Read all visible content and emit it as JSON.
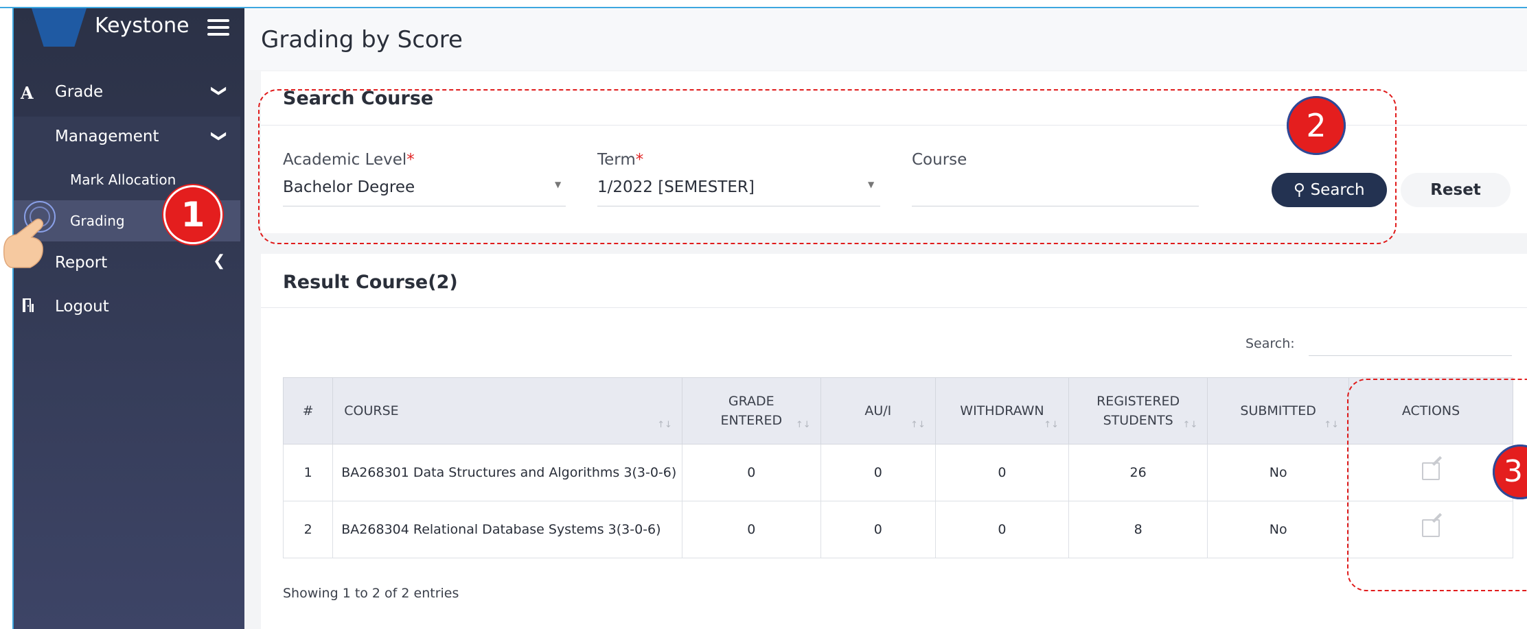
{
  "app": {
    "brand": "Keystone"
  },
  "sidebar": {
    "items": [
      {
        "icon": "A",
        "label": "Grade",
        "chevron": "❯"
      },
      {
        "label": "Management",
        "chevron": "❯"
      },
      {
        "label": "Mark Allocation"
      },
      {
        "label": "Grading"
      },
      {
        "label": "Report",
        "chevron": "❮"
      },
      {
        "icon": "door-icon",
        "label": "Logout"
      }
    ]
  },
  "annotations": {
    "step1": "1",
    "step2": "2",
    "step3": "3"
  },
  "page": {
    "title": "Grading by Score"
  },
  "search_card": {
    "title": "Search Course",
    "academic_level": {
      "label": "Academic Level",
      "required": "*",
      "value": "Bachelor Degree"
    },
    "term": {
      "label": "Term",
      "required": "*",
      "value": "1/2022 [SEMESTER]"
    },
    "course": {
      "label": "Course",
      "value": ""
    },
    "search_button": "Search",
    "reset_button": "Reset"
  },
  "result_card": {
    "title": "Result Course(2)",
    "search_label": "Search:",
    "columns": [
      "#",
      "COURSE",
      "GRADE ENTERED",
      "AU/I",
      "WITHDRAWN",
      "REGISTERED STUDENTS",
      "SUBMITTED",
      "ACTIONS"
    ],
    "rows": [
      {
        "num": "1",
        "course": "BA268301 Data Structures and Algorithms 3(3-0-6)",
        "grade_entered": "0",
        "aui": "0",
        "withdrawn": "0",
        "registered": "26",
        "submitted": "No"
      },
      {
        "num": "2",
        "course": "BA268304 Relational Database Systems 3(3-0-6)",
        "grade_entered": "0",
        "aui": "0",
        "withdrawn": "0",
        "registered": "8",
        "submitted": "No"
      }
    ],
    "footer": "Showing 1 to 2 of 2 entries"
  },
  "colors": {
    "sidebar": "#2b3146",
    "accent_button": "#233251",
    "highlight": "#e01b1b",
    "status_no": "#c62828"
  }
}
